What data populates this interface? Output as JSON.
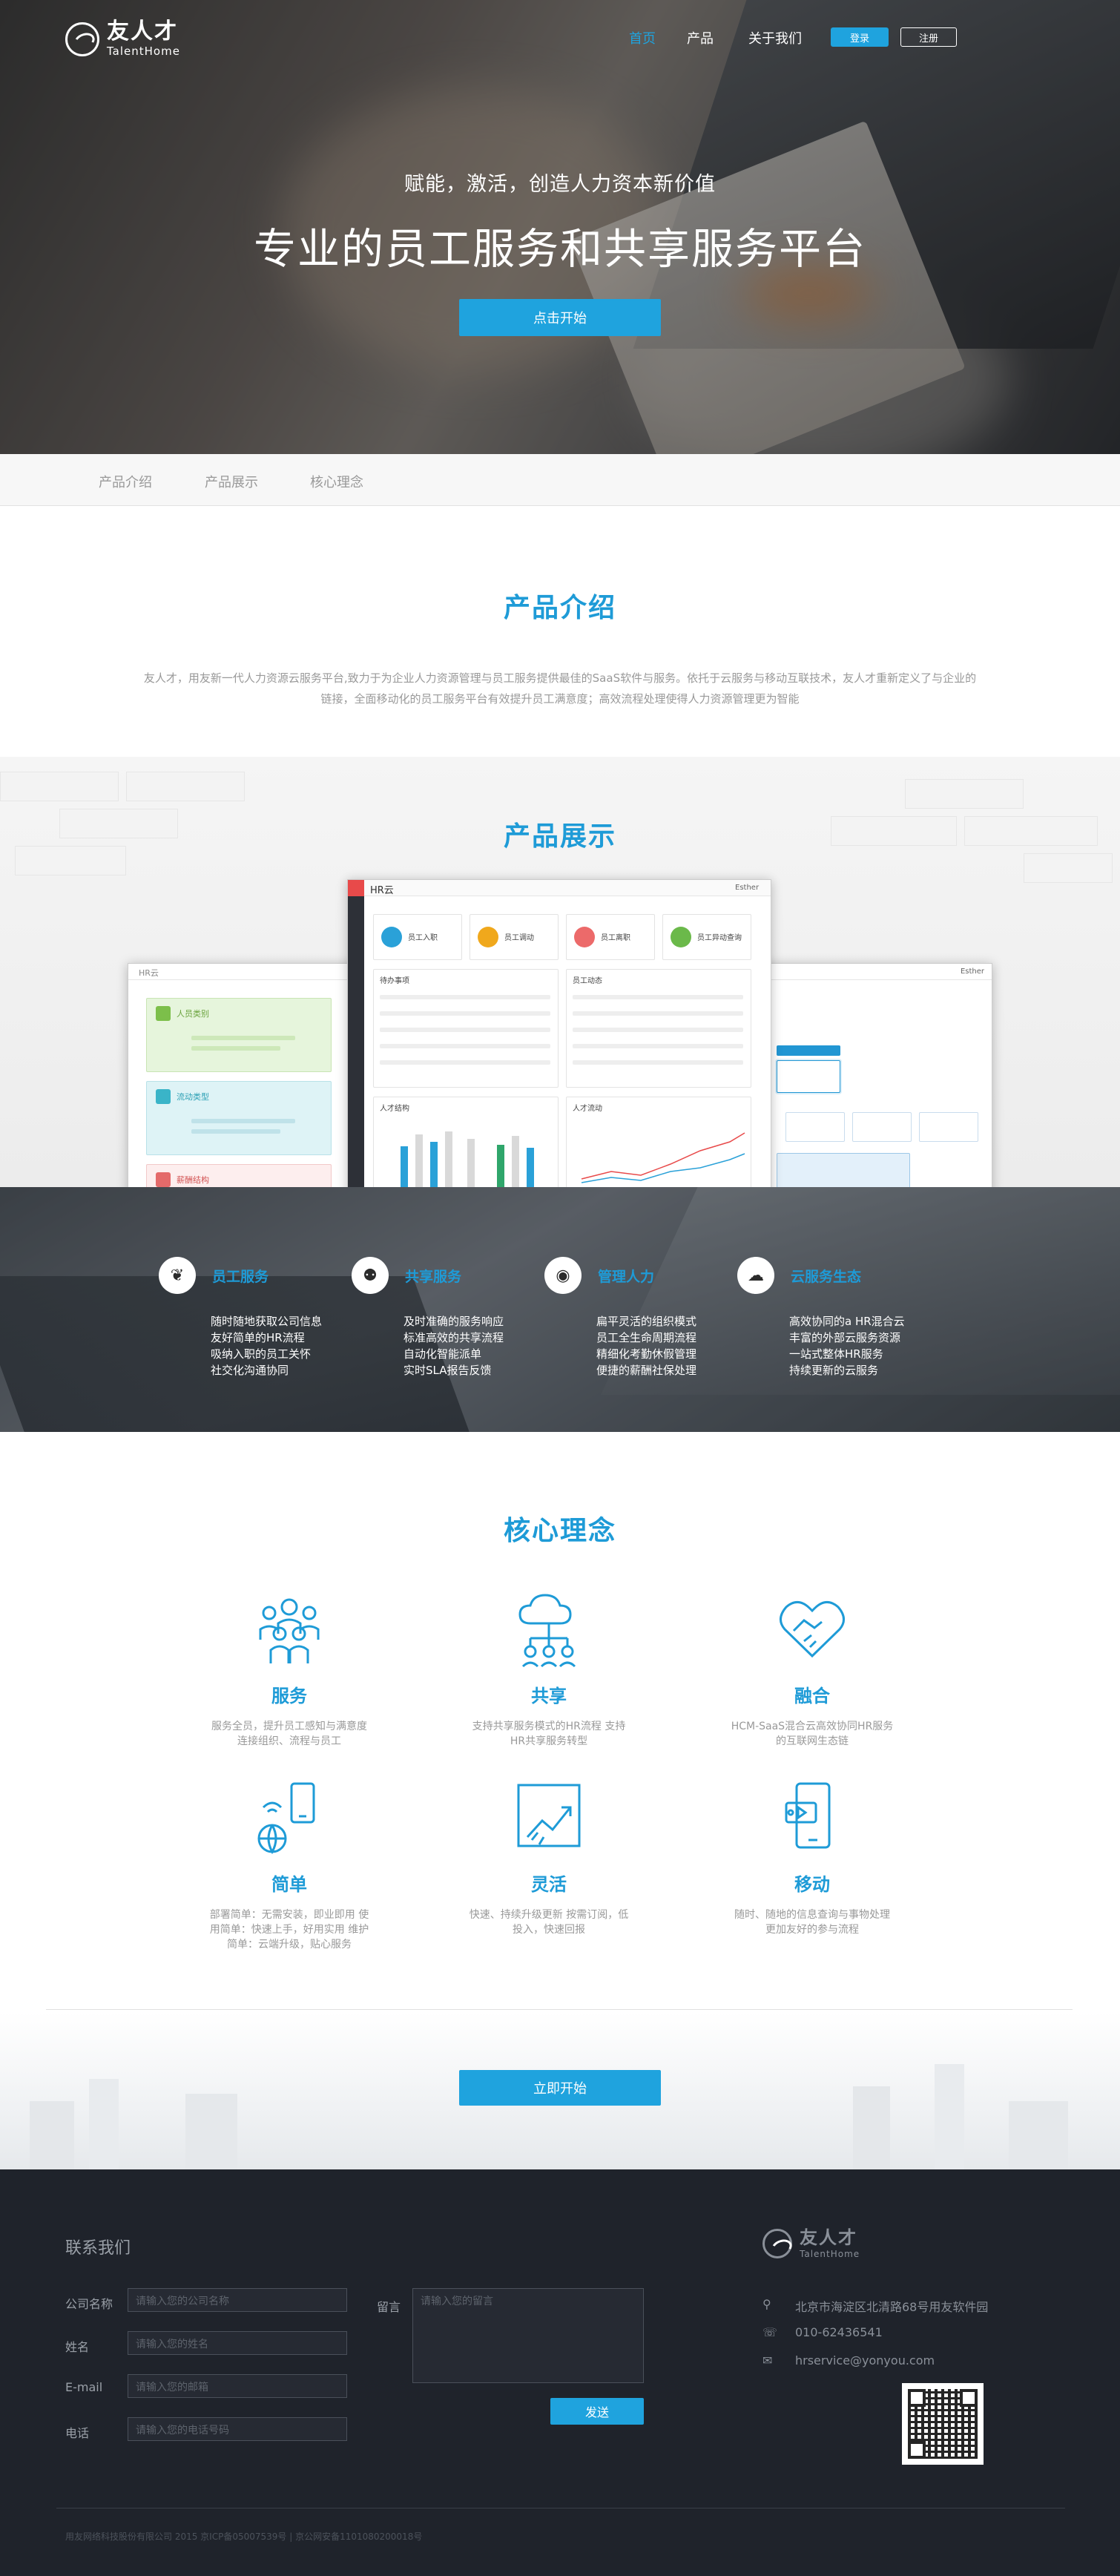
{
  "header": {
    "brand_cn": "友人才",
    "brand_en": "TalentHome",
    "nav": [
      "首页",
      "产品",
      "关于我们"
    ],
    "login": "登录",
    "register": "注册"
  },
  "hero": {
    "subtitle": "赋能，激活，创造人力资本新价值",
    "title": "专业的员工服务和共享服务平台",
    "cta": "点击开始"
  },
  "tabs": [
    "产品介绍",
    "产品展示",
    "核心理念"
  ],
  "intro": {
    "title": "产品介绍",
    "text": "友人才，用友新一代人力资源云服务平台,致力于为企业人力资源管理与员工服务提供最佳的SaaS软件与服务。依托于云服务与移动互联技术，友人才重新定义了与企业的链接，全面移动化的员工服务平台有效提升员工满意度；高效流程处理使得人力资源管理更为智能"
  },
  "showcase": {
    "title": "产品展示",
    "app_name": "HR云",
    "user": "Esther",
    "cards": [
      "员工入职",
      "员工调动",
      "员工离职",
      "员工异动查询"
    ],
    "panel1": "待办事项",
    "panel2": "员工动态",
    "panel3": "人才结构",
    "panel4": "人才流动",
    "left_cards": [
      "人员类别",
      "流动类型",
      "薪酬结构"
    ]
  },
  "features": [
    {
      "title": "员工服务",
      "lines": [
        "随时随地获取公司信息",
        "友好简单的HR流程",
        "吸纳入职的员工关怀",
        "社交化沟通协同"
      ]
    },
    {
      "title": "共享服务",
      "lines": [
        "及时准确的服务响应",
        "标准高效的共享流程",
        "自动化智能派单",
        "实时SLA报告反馈"
      ]
    },
    {
      "title": "管理人力",
      "lines": [
        "扁平灵活的组织模式",
        "员工全生命周期流程",
        "精细化考勤休假管理",
        "便捷的薪酬社保处理"
      ]
    },
    {
      "title": "云服务生态",
      "lines": [
        "高效协同的a HR混合云",
        "丰富的外部云服务资源",
        "一站式整体HR服务",
        "持续更新的云服务"
      ]
    }
  ],
  "core": {
    "title": "核心理念",
    "items": [
      {
        "icon": "people-group-icon",
        "title": "服务",
        "desc": "服务全员，提升员工感知与满意度 连接组织、流程与员工"
      },
      {
        "icon": "cloud-share-icon",
        "title": "共享",
        "desc": "支持共享服务模式的HR流程 支持HR共享服务转型"
      },
      {
        "icon": "handshake-icon",
        "title": "融合",
        "desc": "HCM-SaaS混合云高效协同HR服务的互联网生态链"
      },
      {
        "icon": "globe-phone-icon",
        "title": "简单",
        "desc": "部署简单：无需安装，即业即用 使用简单：快速上手，好用实用 维护简单：云端升级，贴心服务"
      },
      {
        "icon": "rocket-chart-icon",
        "title": "灵活",
        "desc": "快速、持续升级更新 按需订阅，低投入，快速回报"
      },
      {
        "icon": "mobile-screen-icon",
        "title": "移动",
        "desc": "随时、随地的信息查询与事物处理更加友好的参与流程"
      }
    ]
  },
  "bottom_cta": "立即开始",
  "footer": {
    "contact_title": "联系我们",
    "fields": [
      {
        "label": "公司名称",
        "placeholder": "请输入您的公司名称"
      },
      {
        "label": "姓名",
        "placeholder": "请输入您的姓名"
      },
      {
        "label": "E-mail",
        "placeholder": "请输入您的邮箱"
      },
      {
        "label": "电话",
        "placeholder": "请输入您的电话号码"
      }
    ],
    "message_label": "留言",
    "message_placeholder": "请输入您的留言",
    "send": "发送",
    "address": "北京市海淀区北清路68号用友软件园",
    "phone": "010-62436541",
    "email": "hrservice@yonyou.com",
    "copyright": "用友网络科技股份有限公司 2015 京ICP备05007539号 | 京公网安备1101080200018号"
  }
}
